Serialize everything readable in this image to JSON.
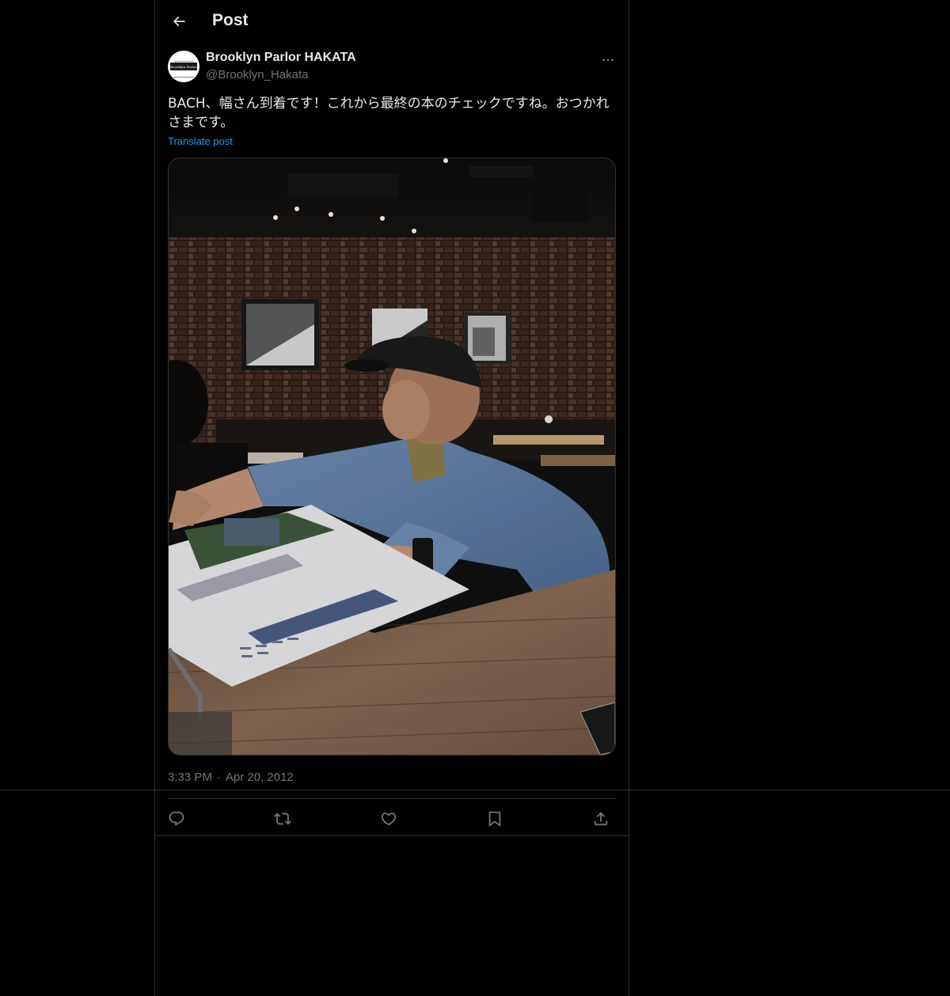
{
  "header": {
    "title": "Post"
  },
  "post": {
    "author_name": "Brooklyn Parlor HAKATA",
    "author_handle": "@Brooklyn_Hakata",
    "avatar_text": "Brooklyn Parlor",
    "text": "BACH、幅さん到着です！これから最終の本のチェックですね。おつかれさまです。",
    "translate_label": "Translate post",
    "time": "3:33 PM",
    "date": "Apr 20, 2012"
  },
  "actions": {
    "reply_icon": "reply-icon",
    "repost_icon": "repost-icon",
    "like_icon": "heart-icon",
    "bookmark_icon": "bookmark-icon",
    "share_icon": "share-icon"
  },
  "colors": {
    "background": "#000000",
    "border": "#2f3336",
    "text_primary": "#e7e9ea",
    "text_secondary": "#71767b",
    "link": "#1d9bf0"
  }
}
